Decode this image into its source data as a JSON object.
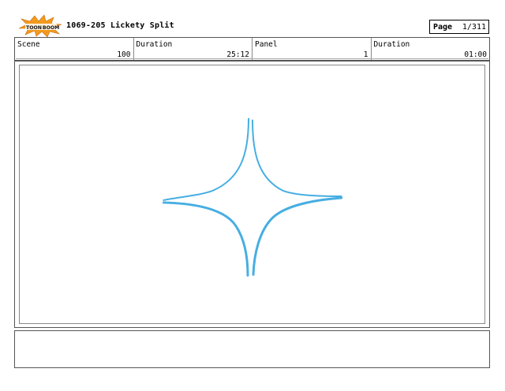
{
  "header": {
    "logo_text_left": "TOON",
    "logo_text_right": "BOOM",
    "title": "1069-205 Lickety Split",
    "page_label": "Page",
    "page_value": "1/311"
  },
  "info": {
    "scene_label": "Scene",
    "scene_value": "100",
    "duration_label": "Duration",
    "duration_value": "25:12",
    "panel_label": "Panel",
    "panel_value": "1",
    "panel_duration_label": "Duration",
    "panel_duration_value": "01:00"
  },
  "colors": {
    "sketch_stroke": "#46aee2",
    "logo_burst": "#f39a1d",
    "logo_text": "#111111"
  },
  "panel": {
    "drawing": "four-point-sparkle-sketch"
  }
}
